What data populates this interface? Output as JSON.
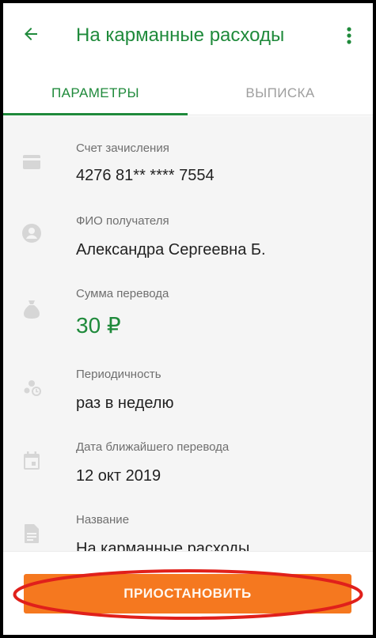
{
  "appbar": {
    "title": "На карманные расходы",
    "back_icon": "arrow-left-icon",
    "more_icon": "more-vert-icon"
  },
  "tabs": [
    {
      "label": "ПАРАМЕТРЫ",
      "active": true
    },
    {
      "label": "ВЫПИСКА",
      "active": false
    }
  ],
  "fields": [
    {
      "icon": "credit-card-icon",
      "label": "Счет зачисления",
      "value": "4276 81** **** 7554"
    },
    {
      "icon": "person-circle-icon",
      "label": "ФИО получателя",
      "value": "Александра Сергеевна Б."
    },
    {
      "icon": "money-bag-icon",
      "label": "Сумма перевода",
      "value": "30 ₽"
    },
    {
      "icon": "periodicity-icon",
      "label": "Периодичность",
      "value": "раз в неделю"
    },
    {
      "icon": "calendar-icon",
      "label": "Дата ближайшего перевода",
      "value": "12 окт 2019"
    },
    {
      "icon": "document-icon",
      "label": "Название",
      "value": "На карманные расходы"
    }
  ],
  "actions": {
    "suspend_label": "ПРИОСТАНОВИТЬ"
  },
  "colors": {
    "accent": "#1f8a3b",
    "button": "#f5781f",
    "annotation": "#e0201b"
  }
}
